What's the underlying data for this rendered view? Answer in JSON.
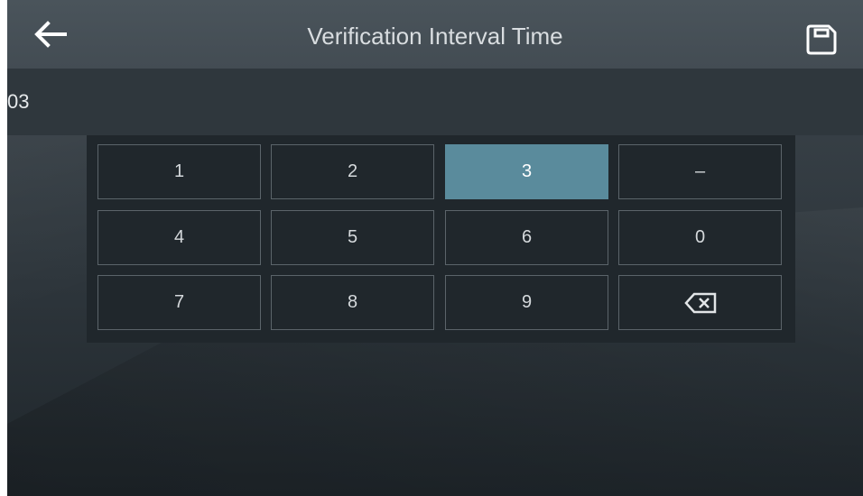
{
  "header": {
    "title": "Verification Interval Time",
    "back_icon": "arrow-left-icon",
    "save_icon": "save-icon"
  },
  "input": {
    "value": "03"
  },
  "keypad": {
    "keys": [
      "1",
      "2",
      "3",
      "–",
      "4",
      "5",
      "6",
      "0",
      "7",
      "8",
      "9",
      "backspace"
    ],
    "pressed_key": "3",
    "backspace_icon": "backspace-icon",
    "accent_color": "#5a8b9c"
  }
}
